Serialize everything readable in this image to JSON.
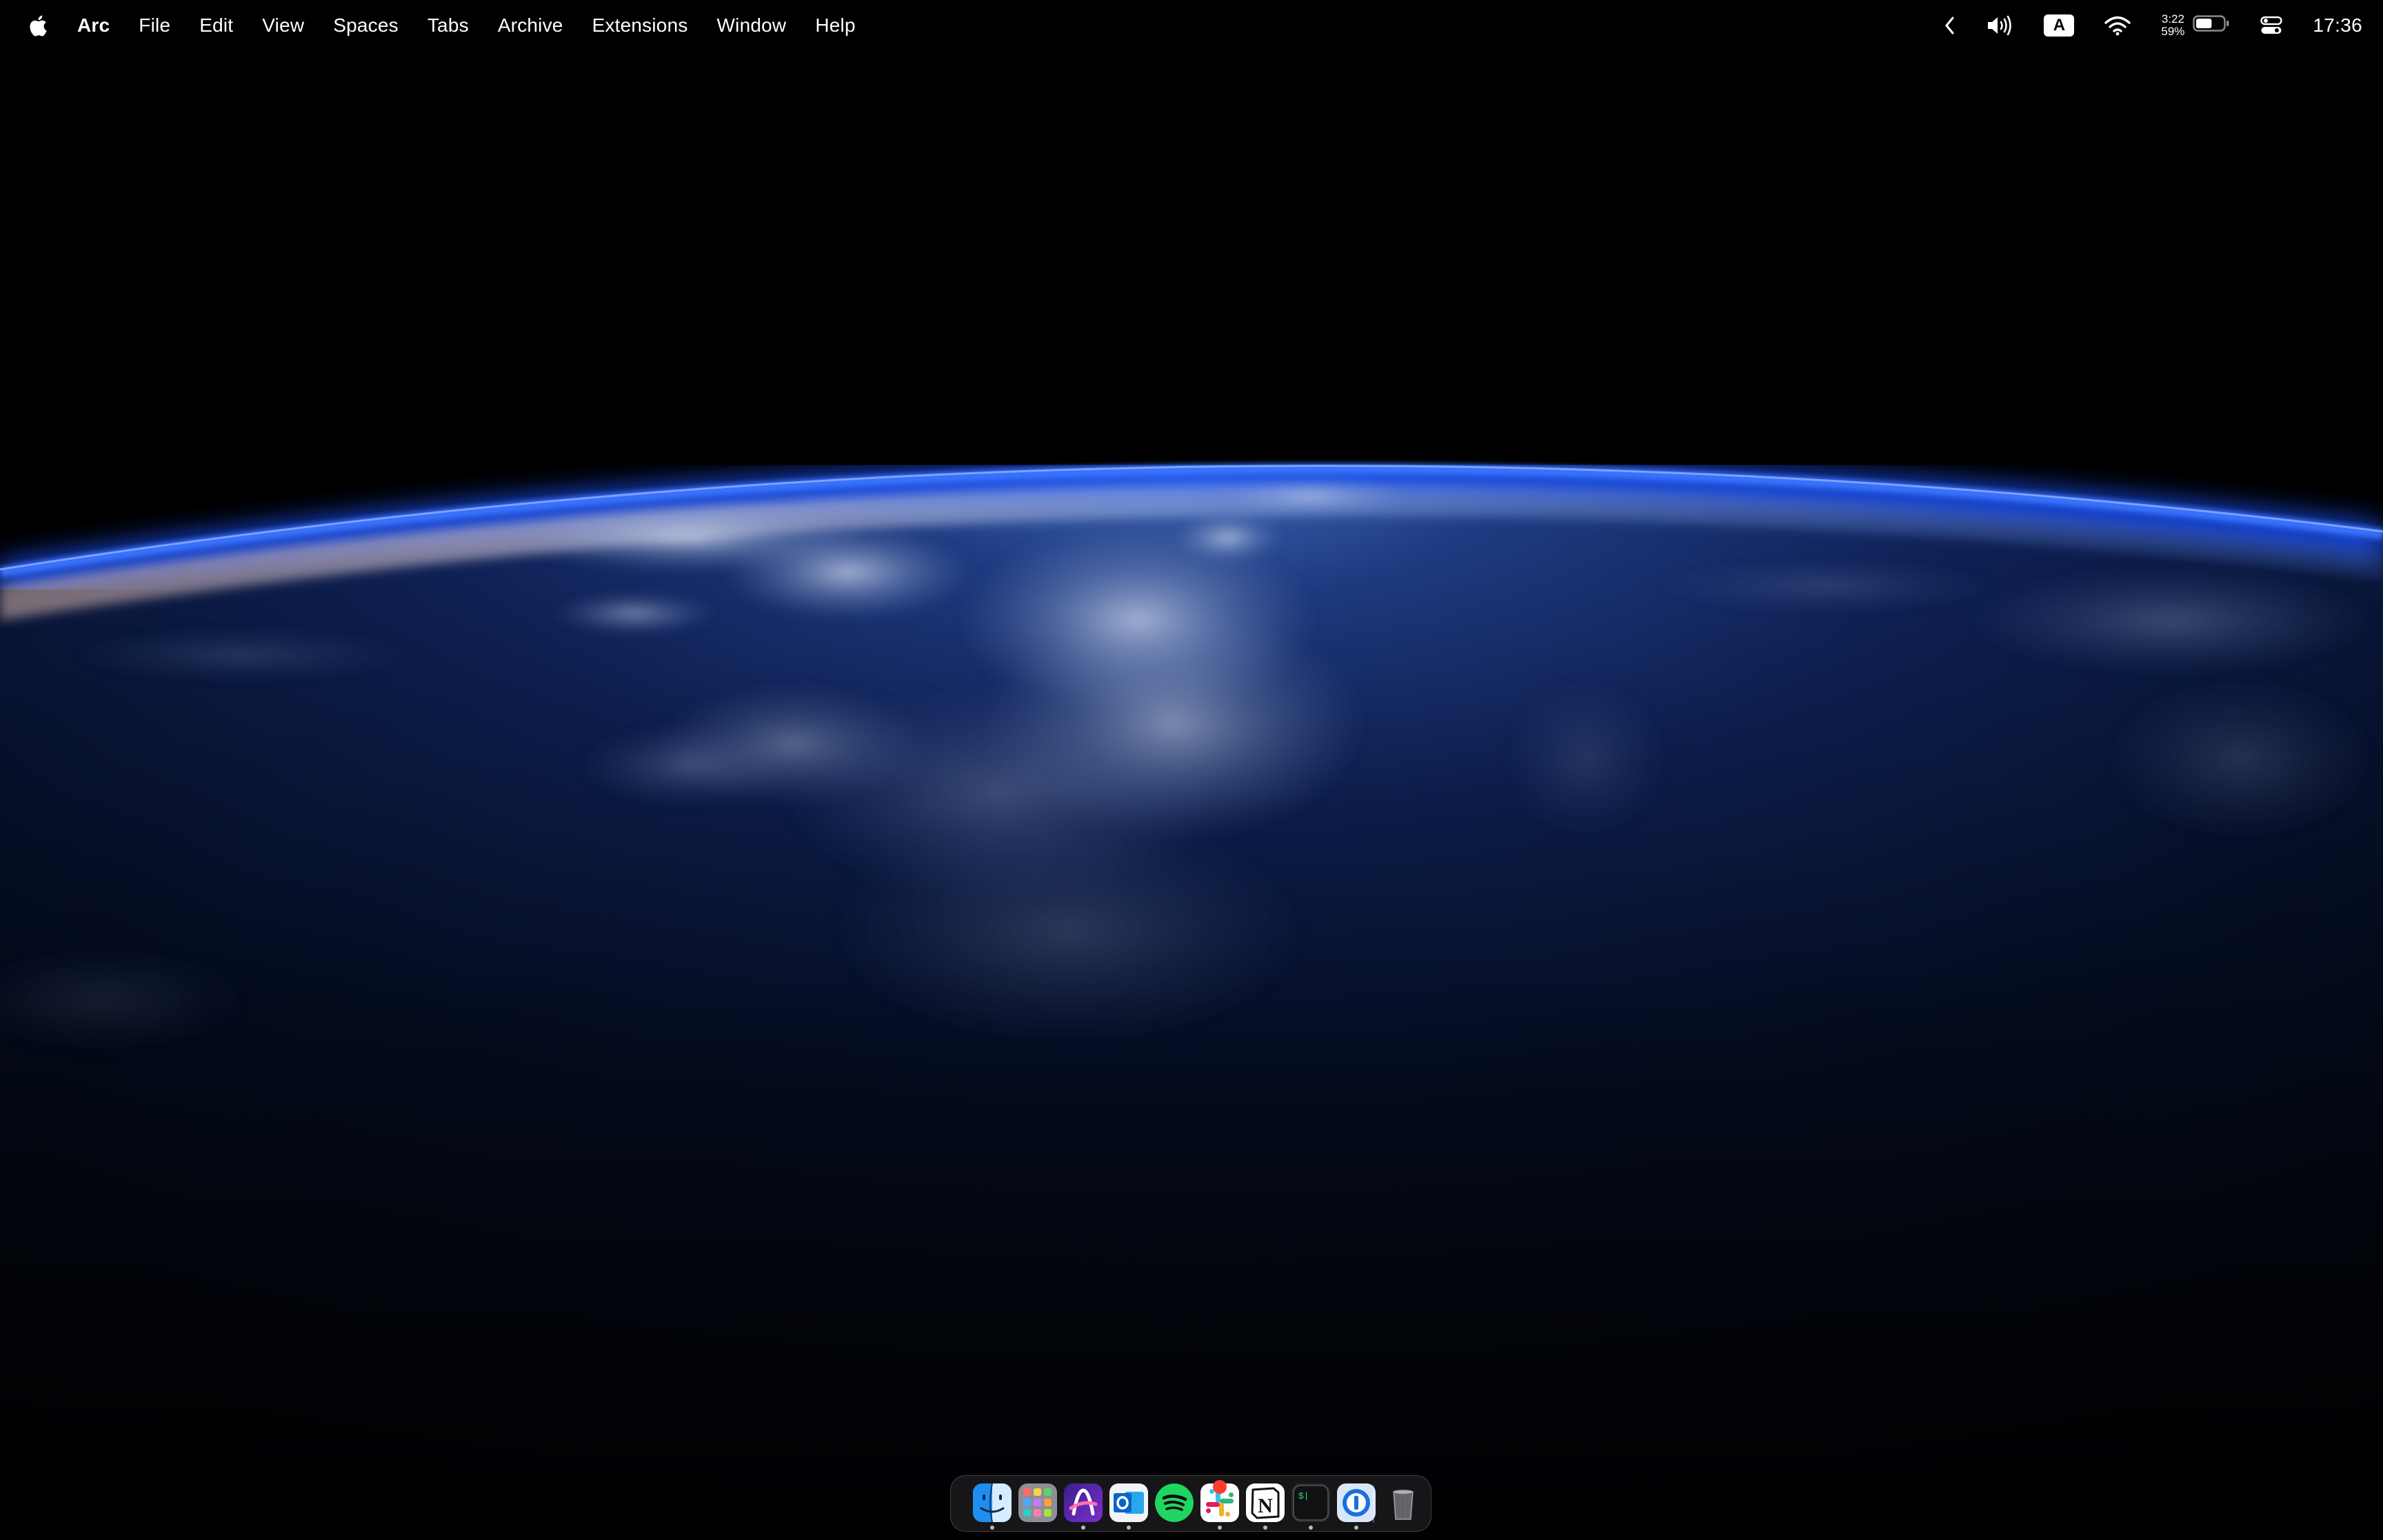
{
  "menubar": {
    "apple_icon": "apple-logo-icon",
    "app_name": "Arc",
    "menus": [
      "File",
      "Edit",
      "View",
      "Spaces",
      "Tabs",
      "Archive",
      "Extensions",
      "Window",
      "Help"
    ],
    "status": {
      "collapse_icon": "chevron-left-icon",
      "volume_icon": "speaker-volume-icon",
      "input_source": "A",
      "wifi_icon": "wifi-icon",
      "battery_time": "3:22",
      "battery_percent": "59%",
      "battery_level": 0.59,
      "battery_icon": "battery-icon",
      "control_center_icon": "control-center-icon",
      "clock": "17:36"
    }
  },
  "wallpaper": {
    "description_icon": "earth-from-space-wallpaper",
    "atmosphere_color": "#2a5cff",
    "space_color": "#000000"
  },
  "dock": {
    "apps": [
      {
        "name": "Finder",
        "icon": "finder-icon",
        "running": true
      },
      {
        "name": "Launchpad",
        "icon": "launchpad-icon",
        "running": false
      },
      {
        "name": "Arc",
        "icon": "arc-browser-icon",
        "running": true
      },
      {
        "name": "Outlook",
        "icon": "outlook-icon",
        "running": true
      },
      {
        "name": "Spotify",
        "icon": "spotify-icon",
        "running": false
      },
      {
        "name": "Slack",
        "icon": "slack-icon",
        "running": true,
        "badge": true
      },
      {
        "name": "Notion",
        "icon": "notion-icon",
        "running": true
      },
      {
        "name": "Terminal",
        "icon": "terminal-icon",
        "running": true
      },
      {
        "name": "1Password",
        "icon": "1password-icon",
        "running": true
      }
    ],
    "trash": {
      "name": "Trash",
      "icon": "trash-icon"
    },
    "colors": {
      "finder": "#1e8ff0",
      "spotify": "#1ed760",
      "outlook": "#0a64c8",
      "arc": "#5b2bb5",
      "onepassword": "#1a6fe0",
      "badge": "#ff3b30"
    }
  }
}
